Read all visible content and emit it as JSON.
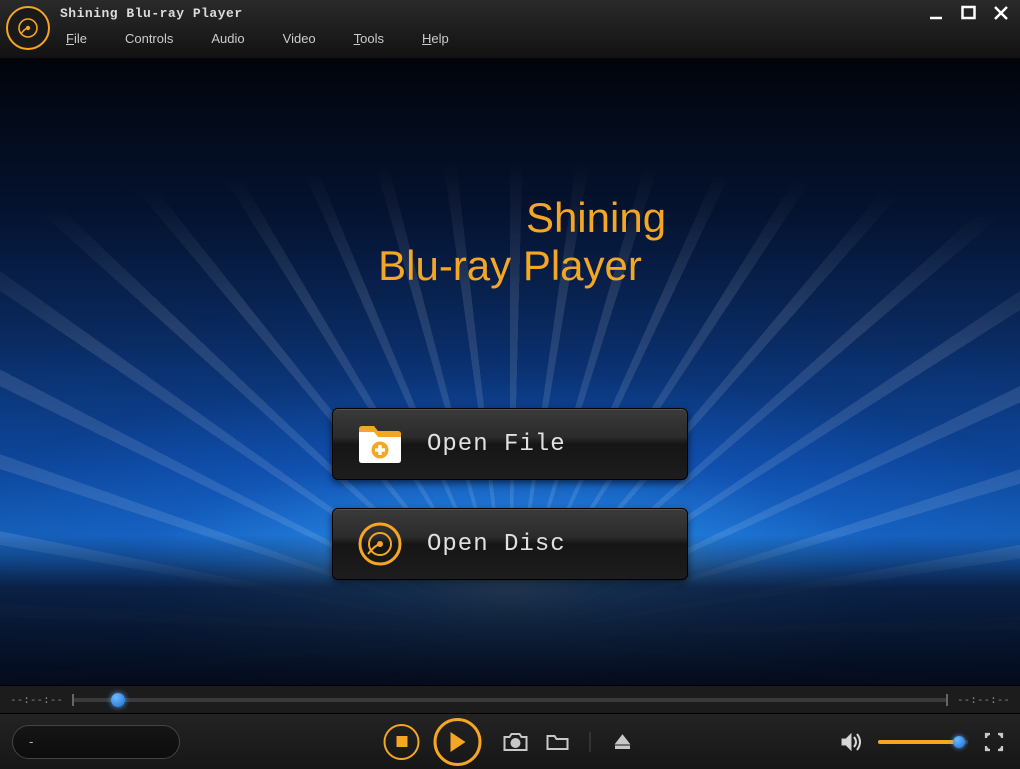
{
  "app_title": "Shining Blu-ray Player",
  "menu": {
    "file": {
      "hotkey": "F",
      "rest": "ile"
    },
    "controls": {
      "label": "Controls"
    },
    "audio": {
      "label": "Audio"
    },
    "video": {
      "label": "Video"
    },
    "tools": {
      "hotkey": "T",
      "rest": "ools"
    },
    "help": {
      "hotkey": "H",
      "rest": "elp"
    }
  },
  "brand": {
    "line1": "Shining",
    "line2": "Blu-ray Player"
  },
  "open": {
    "file": "Open File",
    "disc": "Open Disc"
  },
  "seek": {
    "elapsed": "--:--:--",
    "total": "--:--:--"
  },
  "track": {
    "now_playing": "-"
  },
  "colors": {
    "accent": "#f5a623",
    "thumb": "#2a8ae6"
  }
}
